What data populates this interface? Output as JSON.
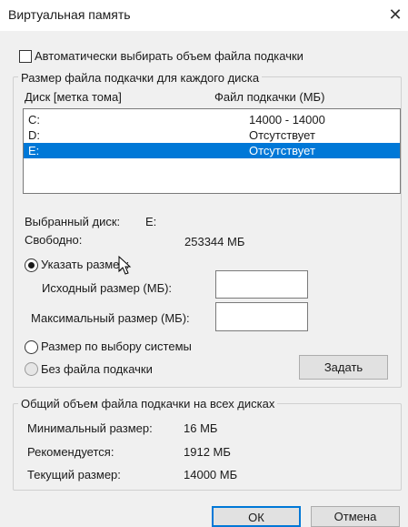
{
  "window": {
    "title": "Виртуальная память"
  },
  "auto_checkbox": {
    "label": "Автоматически выбирать объем файла подкачки",
    "checked": false
  },
  "per_disk": {
    "legend": "Размер файла подкачки для каждого диска",
    "columns": {
      "disk": "Диск [метка тома]",
      "file": "Файл подкачки (МБ)"
    },
    "rows": [
      {
        "disk": "C:",
        "file": "14000 - 14000",
        "selected": false
      },
      {
        "disk": "D:",
        "file": "Отсутствует",
        "selected": false
      },
      {
        "disk": "E:",
        "file": "Отсутствует",
        "selected": true
      }
    ],
    "selected_disk_label": "Выбранный диск:",
    "selected_disk_value": "E:",
    "free_label": "Свободно:",
    "free_value": "253344 МБ",
    "options": {
      "custom": {
        "label": "Указать размер:",
        "selected": true
      },
      "initial_label": "Исходный размер (МБ):",
      "initial_value": "",
      "max_label": "Максимальный размер (МБ):",
      "max_value": "",
      "system": {
        "label": "Размер по выбору системы",
        "selected": false
      },
      "none": {
        "label": "Без файла подкачки",
        "selected": false
      }
    },
    "set_button": "Задать"
  },
  "totals": {
    "legend": "Общий объем файла подкачки на всех дисках",
    "min_label": "Минимальный размер:",
    "min_value": "16 МБ",
    "recommended_label": "Рекомендуется:",
    "recommended_value": "1912 МБ",
    "current_label": "Текущий размер:",
    "current_value": "14000 МБ"
  },
  "buttons": {
    "ok": "ОК",
    "cancel": "Отмена"
  },
  "icons": {
    "close": "close-icon",
    "cursor": "mouse-pointer-icon"
  }
}
